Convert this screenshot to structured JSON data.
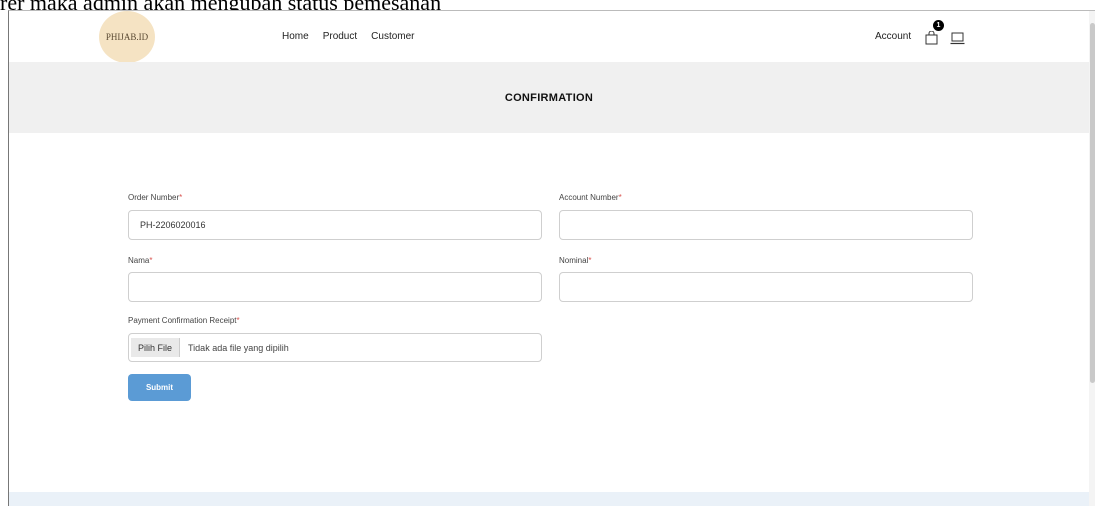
{
  "caption": "rer maka admin akan mengubah status pemesanan",
  "brand": {
    "logo_text": "PHIJAB.ID",
    "logo_color": "#f5e3c3"
  },
  "nav": {
    "links": [
      "Home",
      "Product",
      "Customer"
    ],
    "account_label": "Account",
    "cart_count": "1"
  },
  "icons": {
    "cart": "shopping-bag-icon",
    "device": "laptop-icon"
  },
  "banner": {
    "title": "CONFIRMATION",
    "background": "#f0f0f0"
  },
  "form": {
    "order_number": {
      "label": "Order Number",
      "value": "PH-2206020016"
    },
    "account_number": {
      "label": "Account Number",
      "value": ""
    },
    "nama": {
      "label": "Nama",
      "value": ""
    },
    "nominal": {
      "label": "Nominal",
      "value": ""
    },
    "receipt": {
      "label": "Payment Confirmation Receipt",
      "button_label": "Pilih File",
      "status": "Tidak ada file yang dipilih"
    },
    "required_mark": "*",
    "submit_label": "Submit"
  },
  "colors": {
    "accent": "#5b9bd5",
    "required": "#d9534f"
  }
}
